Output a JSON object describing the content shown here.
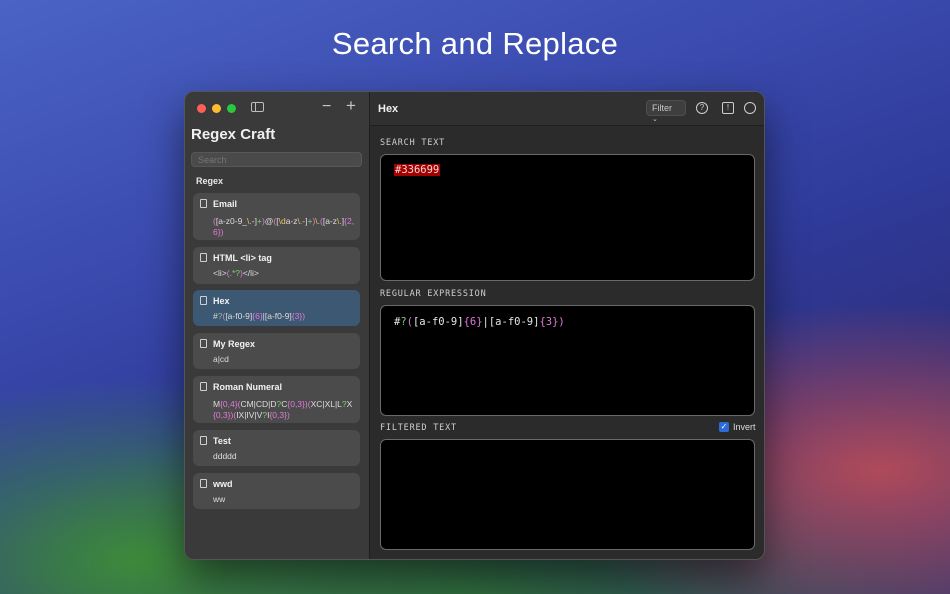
{
  "headline": "Search and Replace",
  "sidebar": {
    "app_title": "Regex Craft",
    "search_placeholder": "Search",
    "section_label": "Regex",
    "items": [
      {
        "name": "Email",
        "pattern": "([a-z0-9_\\.-]+)@([\\da-z\\.-]+)\\.([a-z\\.]{2,6})"
      },
      {
        "name": "HTML <li> tag",
        "pattern": "<li>(.*?)</li>"
      },
      {
        "name": "Hex",
        "pattern": "#?([a-f0-9]{6}|[a-f0-9]{3})"
      },
      {
        "name": "My Regex",
        "pattern": "a|cd"
      },
      {
        "name": "Roman Numeral",
        "pattern": "M{0,4}(CM|CD|D?C{0,3})(XC|XL|L?X{0,3})(IX|IV|V?I{0,3})"
      },
      {
        "name": "Test",
        "pattern": "ddddd"
      },
      {
        "name": "wwd",
        "pattern": "ww"
      }
    ]
  },
  "toolbar": {
    "title": "Hex",
    "filter_label": "Filter",
    "help_icon_glyph": "?",
    "warn_icon_glyph": "!"
  },
  "main": {
    "search_label": "SEARCH TEXT",
    "search_text": "#336699",
    "regex_label": "REGULAR EXPRESSION",
    "regex_text": "#?([a-f0-9]{6}|[a-f0-9]{3})",
    "filtered_label": "FILTERED TEXT",
    "invert_label": "Invert",
    "invert_checked": true,
    "filtered_text": ""
  },
  "colors": {
    "selection": "#3d5872",
    "match_highlight": "#a00000",
    "checkbox_accent": "#2c6bd8"
  }
}
